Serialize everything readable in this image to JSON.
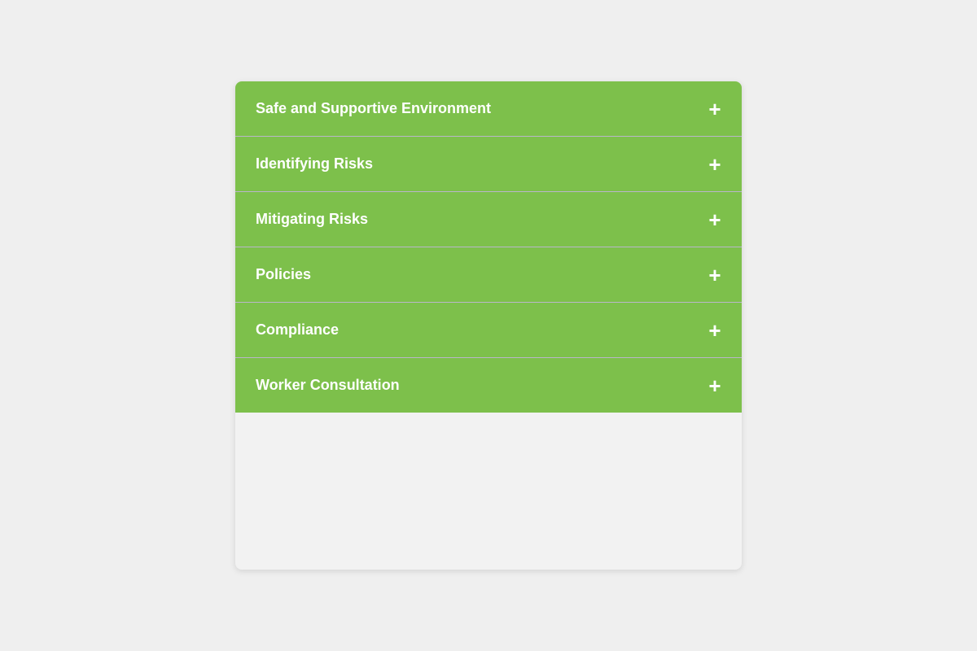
{
  "accordion": {
    "items": [
      {
        "title": "Safe and Supportive Environment",
        "toggle": "+"
      },
      {
        "title": "Identifying Risks",
        "toggle": "+"
      },
      {
        "title": "Mitigating Risks",
        "toggle": "+"
      },
      {
        "title": "Policies",
        "toggle": "+"
      },
      {
        "title": "Compliance",
        "toggle": "+"
      },
      {
        "title": "Worker Consultation",
        "toggle": "+"
      }
    ]
  },
  "colors": {
    "page_background": "#efefef",
    "card_background": "#f2f2f2",
    "header_background": "#7dc04b",
    "header_text": "#ffffff",
    "divider": "#b9b6c9"
  }
}
